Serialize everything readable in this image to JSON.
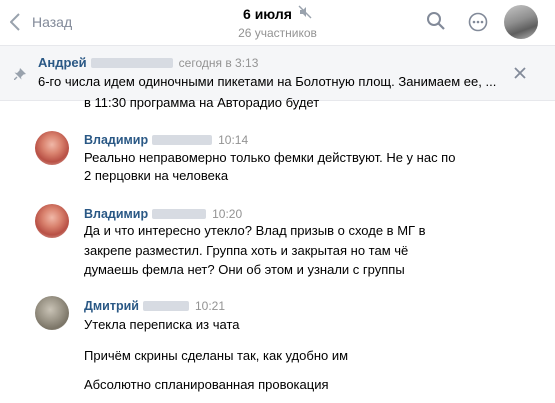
{
  "header": {
    "back_label": "Назад",
    "title": "6 июля",
    "subtitle": "26 участников"
  },
  "pinned": {
    "author": "Андрей",
    "time": "сегодня в 3:13",
    "text": "6-го числа идем одиночными пикетами на Болотную площ. Занимаем ее, ..."
  },
  "partial_line": "в 11:30 программа на Авторадио будет",
  "messages": [
    {
      "author": "Владимир",
      "time": "10:14",
      "lines": [
        "Реально неправомерно только фемки действуют. Не у нас по",
        "2 перцовки на человека"
      ]
    },
    {
      "author": "Владимир",
      "time": "10:20",
      "lines": [
        "Да и что интересно утекло? Влад призыв о сходе в МГ в",
        "закрепе разместил. Группа хоть и закрытая но там чё",
        "думаешь фемла нет? Они об этом и узнали с группы"
      ]
    },
    {
      "author": "Дмитрий",
      "time": "10:21",
      "lines": [
        "Утекла переписка из чата",
        "Причём скрины сделаны так, как удобно им",
        "Абсолютно спланированная провокация"
      ]
    }
  ],
  "colors": {
    "link": "#2a5885",
    "muted": "#939393",
    "icon": "#828a99"
  }
}
